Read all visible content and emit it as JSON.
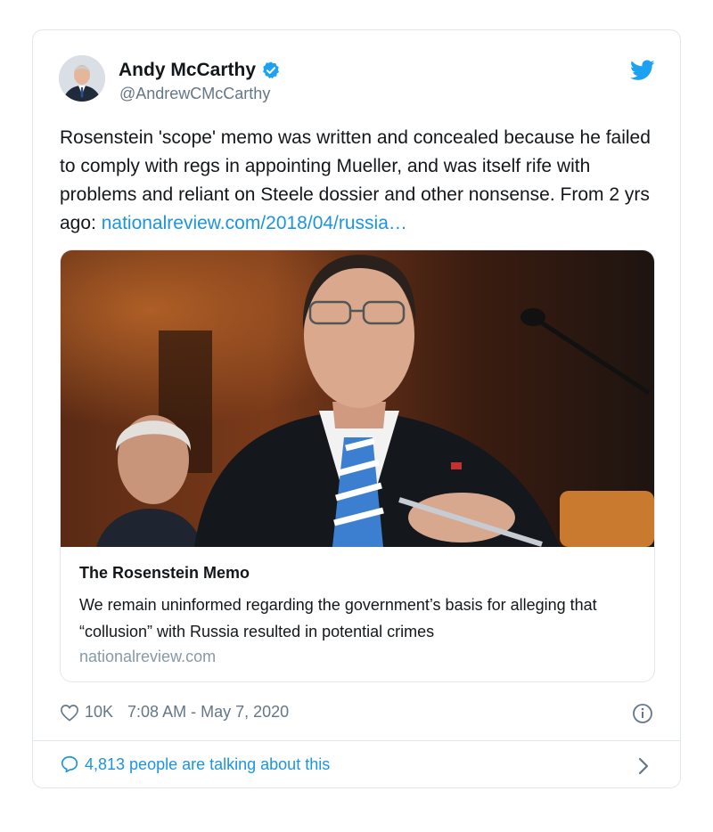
{
  "tweet": {
    "author_name": "Andy McCarthy",
    "author_handle": "@AndrewCMcCarthy",
    "text_main": "Rosenstein 'scope' memo was written and concealed because he failed to comply with regs in appointing Mueller, and was itself rife with problems and reliant on Steele dossier and other nonsense. From 2 yrs ago: ",
    "text_link": "nationalreview.com/2018/04/russia…",
    "card": {
      "title": "The Rosenstein Memo",
      "description": "We remain uninformed regarding the government’s basis for alleging that “collusion” with Russia resulted in potential crimes",
      "domain": "nationalreview.com"
    },
    "likes": "10K",
    "timestamp": "7:08 AM - May 7, 2020",
    "talking": "4,813 people are talking about this"
  },
  "icons": {
    "verified": "verified-badge-icon",
    "brand": "twitter-bird-icon",
    "like": "heart-icon",
    "info": "info-icon",
    "reply": "speech-bubble-icon",
    "more": "chevron-right-icon"
  },
  "colors": {
    "accent": "#1b95e0",
    "muted": "#657786",
    "border": "#e1e8ed"
  }
}
